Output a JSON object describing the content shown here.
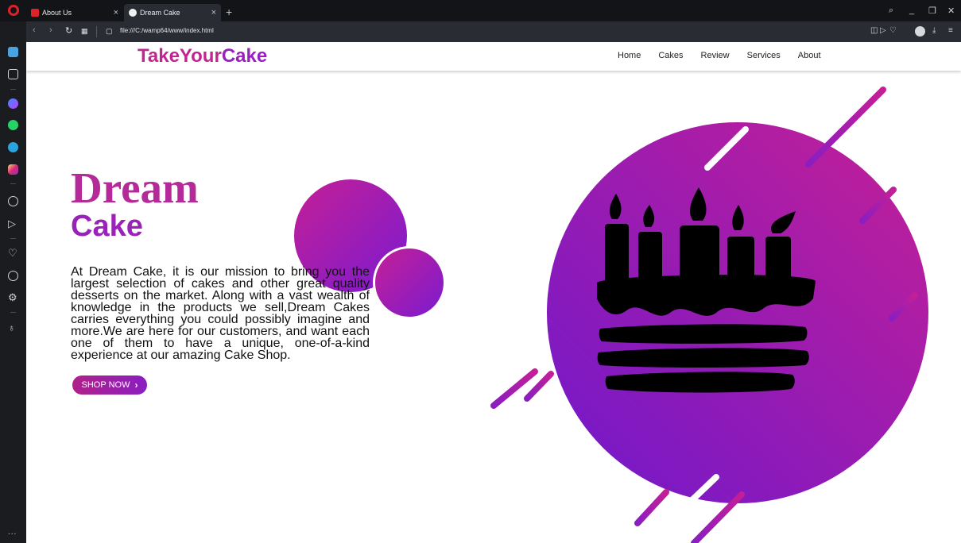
{
  "browser": {
    "tabs": [
      {
        "title": "About Us",
        "close": "×",
        "active": false
      },
      {
        "title": "Dream Cake",
        "close": "×",
        "active": true
      }
    ],
    "new_tab": "+",
    "url": "file:///C:/wamp64/www/index.html",
    "colors": {
      "brand": "#e0212a",
      "chrome_bg": "#131417",
      "toolbar_bg": "#2a2c33"
    }
  },
  "sidebar": {
    "icons": [
      "home-icon",
      "bookmarks-icon",
      "messenger-icon",
      "whatsapp-icon",
      "telegram-icon",
      "instagram-icon",
      "player-icon",
      "flow-icon",
      "heart-icon",
      "history-icon",
      "settings-icon",
      "tips-icon"
    ],
    "more": "..."
  },
  "site": {
    "logo_part1": "TakeYour",
    "logo_part2": "Cake",
    "nav": [
      "Home",
      "Cakes",
      "Review",
      "Services",
      "About"
    ],
    "hero_title_1": "Dream",
    "hero_title_2": "Cake",
    "hero_text": "At Dream Cake, it is our mission to bring you the largest selection of cakes and other great quality desserts on the market. Along with a vast wealth of knowledge in the products we sell,Dream Cakes carries everything you could possibly imagine and more.We are here for our customers, and want each one of them to have a unique, one-of-a-kind experience at our amazing Cake Shop.",
    "cta": "SHOP NOW",
    "cta_icon": "chevron-right-icon",
    "colors": {
      "pink": "#c0268f",
      "purple": "#9a1fbf",
      "gradient_start": "#c41f96",
      "gradient_end": "#7b1bd0"
    }
  }
}
